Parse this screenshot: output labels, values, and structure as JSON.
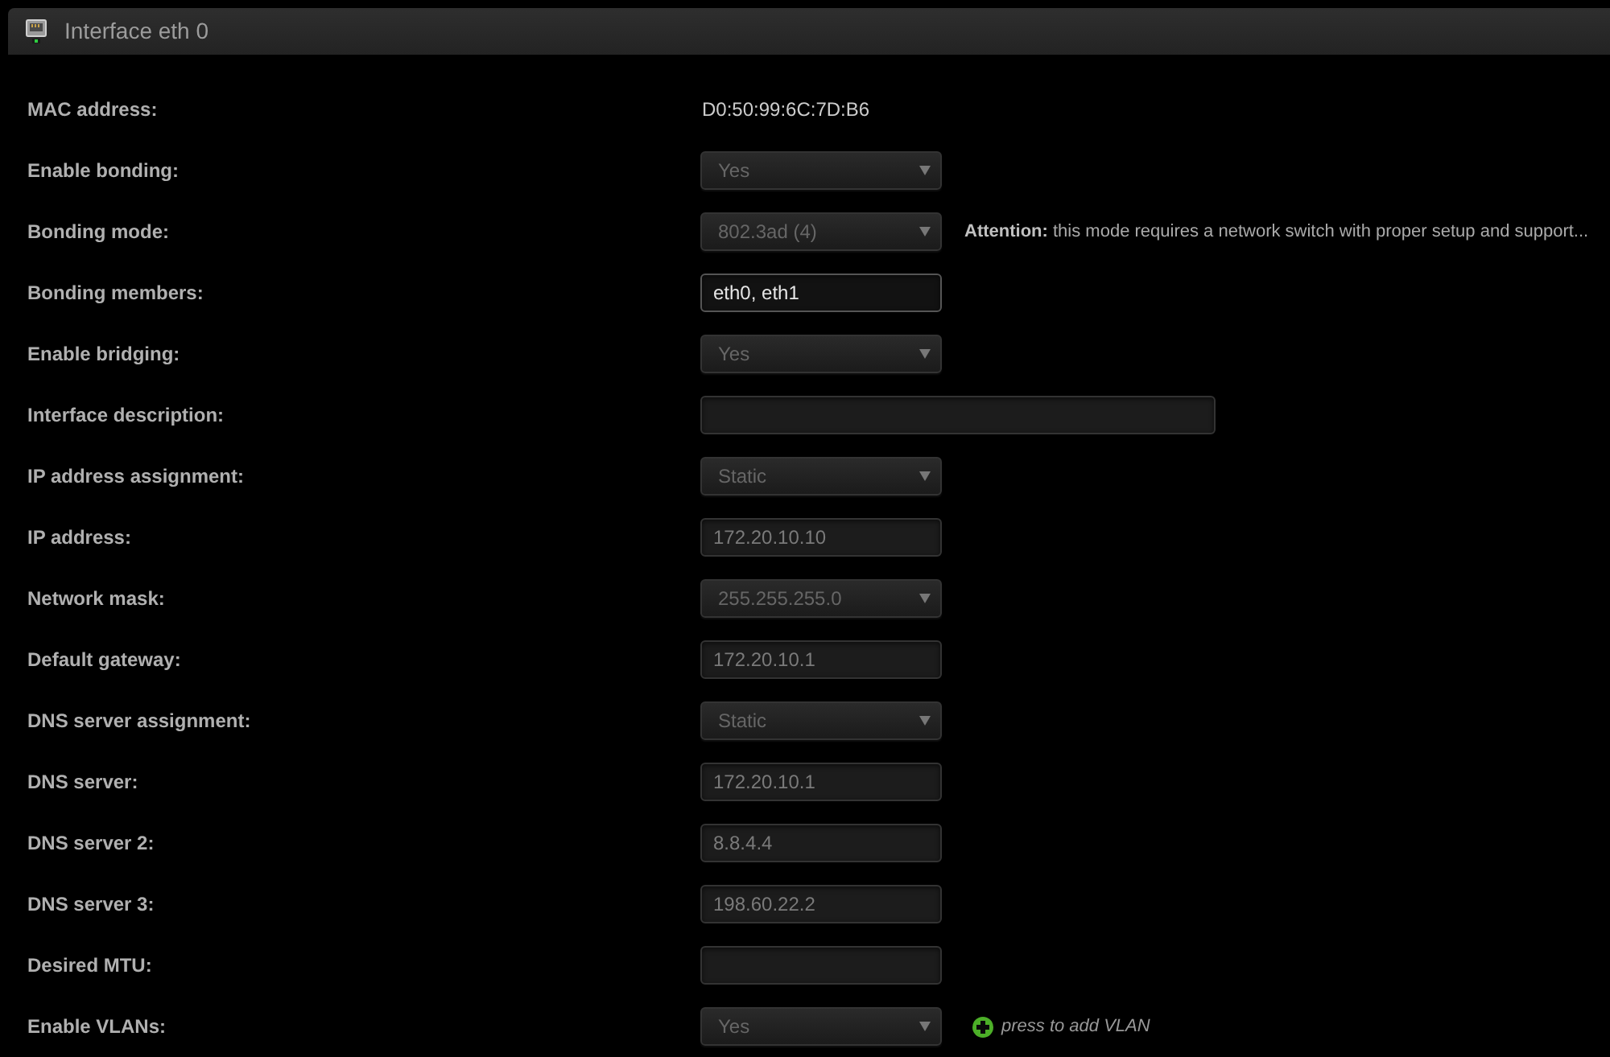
{
  "panel": {
    "title": "Interface eth 0"
  },
  "fields": [
    {
      "label": "MAC address:",
      "kind": "text",
      "value": "D0:50:99:6C:7D:B6"
    },
    {
      "label": "Enable bonding:",
      "kind": "select",
      "value": "Yes",
      "disabled": true
    },
    {
      "label": "Bonding mode:",
      "kind": "select",
      "value": "802.3ad (4)",
      "disabled": true,
      "note": "**Attention:** this mode requires a network switch with proper setup and support..."
    },
    {
      "label": "Bonding members:",
      "kind": "input",
      "value": "eth0, eth1",
      "disabled": false
    },
    {
      "label": "Enable bridging:",
      "kind": "select",
      "value": "Yes",
      "disabled": true
    },
    {
      "label": "Interface description:",
      "kind": "long_input",
      "disabled": true
    },
    {
      "label": "IP address assignment:",
      "kind": "select",
      "value": "Static",
      "disabled": true
    },
    {
      "label": "IP address:",
      "kind": "input",
      "value": "172.20.10.10",
      "disabled": true
    },
    {
      "label": "Network mask:",
      "kind": "select",
      "value": "255.255.255.0",
      "disabled": true
    },
    {
      "label": "Default gateway:",
      "kind": "input",
      "value": "172.20.10.1",
      "disabled": true
    },
    {
      "label": "DNS server assignment:",
      "kind": "select",
      "value": "Static",
      "disabled": true
    },
    {
      "label": "DNS server:",
      "kind": "input",
      "value": "172.20.10.1",
      "disabled": true
    },
    {
      "label": "DNS server 2:",
      "kind": "input",
      "value": "8.8.4.4",
      "disabled": true
    },
    {
      "label": "DNS server 3:",
      "kind": "input",
      "value": "198.60.22.2",
      "disabled": true
    },
    {
      "label": "Desired MTU:",
      "kind": "input",
      "disabled": true
    },
    {
      "label": "Enable VLANs:",
      "kind": "select",
      "value": "Yes",
      "disabled": true,
      "action": {
        "label": "press to add VLAN"
      }
    }
  ]
}
